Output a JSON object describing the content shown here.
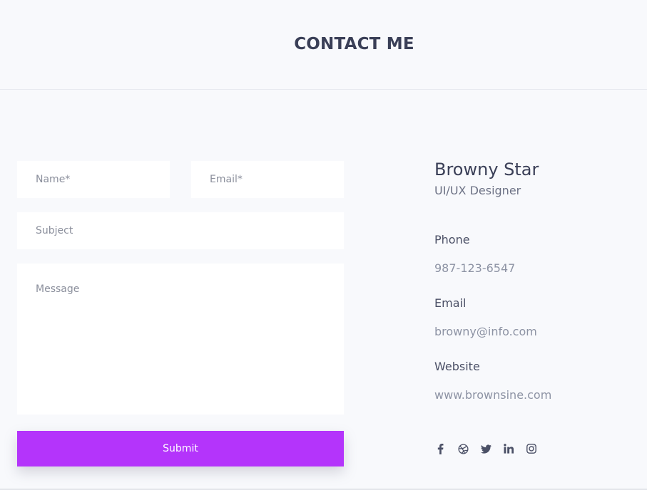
{
  "header": {
    "title": "CONTACT ME"
  },
  "form": {
    "name_placeholder": "Name*",
    "email_placeholder": "Email*",
    "subject_placeholder": "Subject",
    "message_placeholder": "Message",
    "submit_label": "Submit"
  },
  "profile": {
    "name": "Browny Star",
    "role": "UI/UX Designer",
    "phone_label": "Phone",
    "phone": "987-123-6547",
    "email_label": "Email",
    "email": "browny@info.com",
    "website_label": "Website",
    "website": "www.brownsine.com"
  },
  "social": [
    "facebook-icon",
    "dribbble-icon",
    "twitter-icon",
    "linkedin-icon",
    "instagram-icon"
  ],
  "colors": {
    "accent": "#b434fb",
    "background": "#f8f9fc",
    "text": "#3a3f57",
    "muted": "#8d93a4"
  }
}
